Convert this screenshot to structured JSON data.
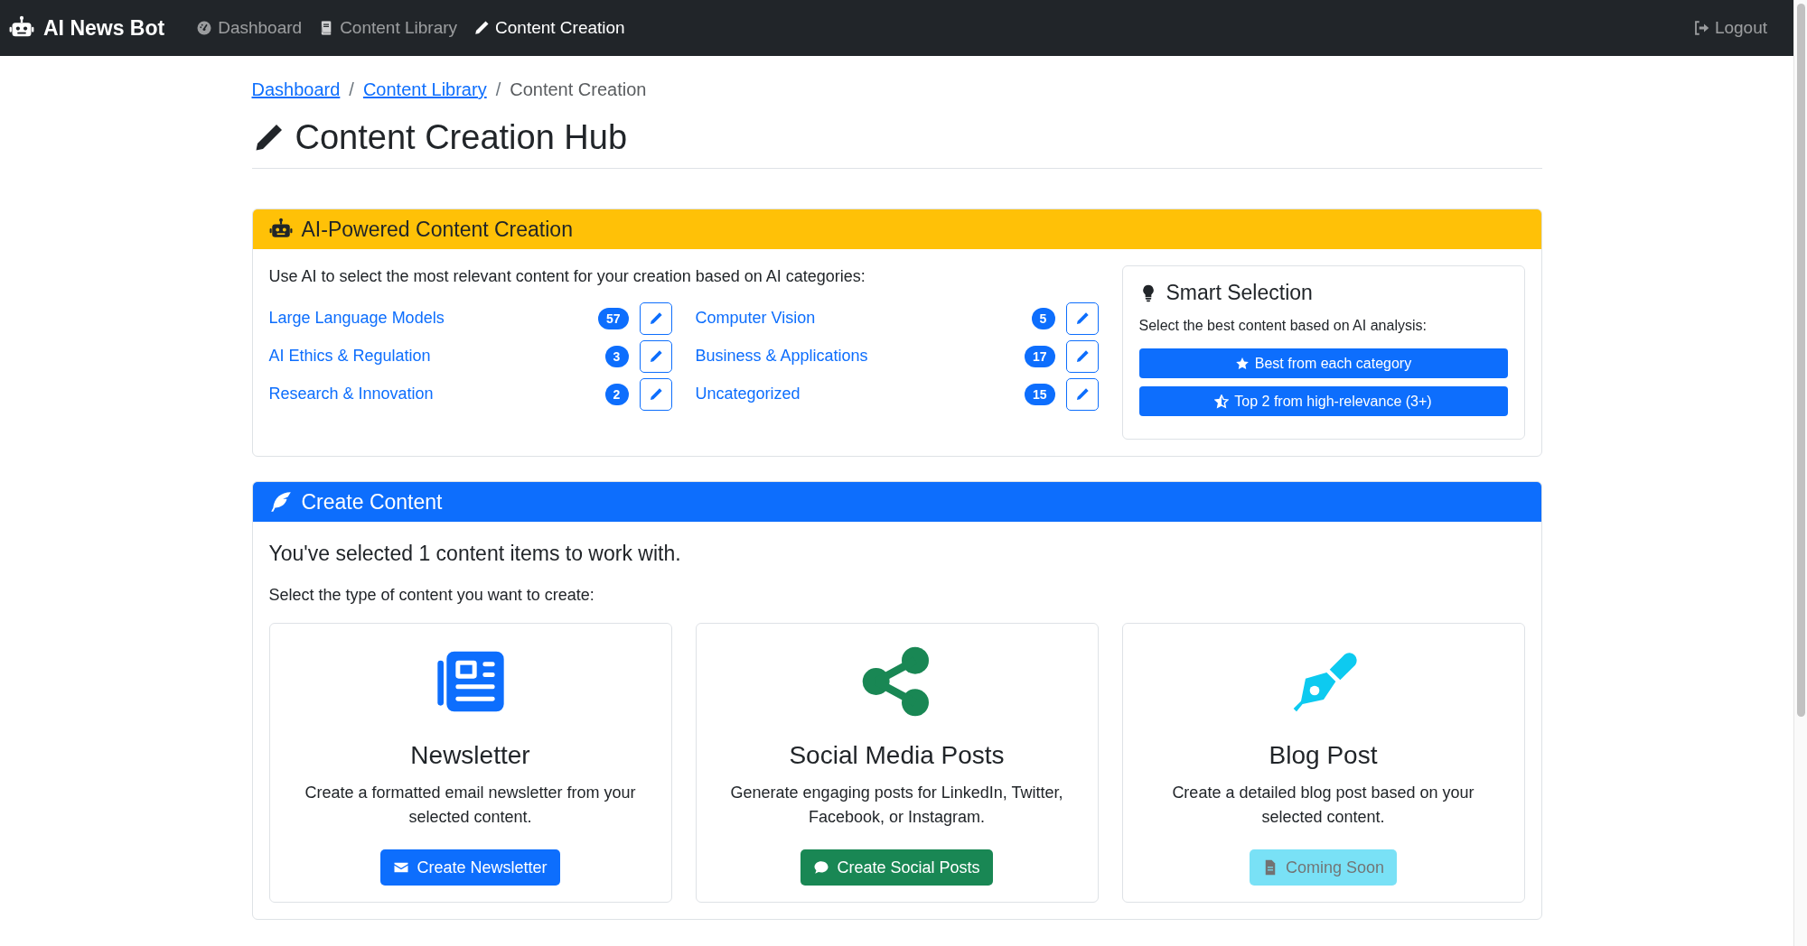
{
  "navbar": {
    "brand": "AI News Bot",
    "items": [
      {
        "label": "Dashboard",
        "kind": "gauge",
        "selected": false
      },
      {
        "label": "Content Library",
        "kind": "book",
        "selected": false
      },
      {
        "label": "Content Creation",
        "kind": "pencil",
        "selected": true
      }
    ],
    "logout": "Logout"
  },
  "breadcrumb": [
    {
      "label": "Dashboard",
      "link": true
    },
    {
      "label": "Content Library",
      "link": true
    },
    {
      "label": "Content Creation",
      "link": false
    }
  ],
  "breadcrumb_separator": "/",
  "page_title": "Content Creation Hub",
  "ai_card": {
    "title": "AI-Powered Content Creation",
    "intro": "Use AI to select the most relevant content for your creation based on AI categories:",
    "categories": [
      {
        "name": "Large Language Models",
        "count": "57"
      },
      {
        "name": "Computer Vision",
        "count": "5"
      },
      {
        "name": "AI Ethics & Regulation",
        "count": "3"
      },
      {
        "name": "Business & Applications",
        "count": "17"
      },
      {
        "name": "Research & Innovation",
        "count": "2"
      },
      {
        "name": "Uncategorized",
        "count": "15"
      }
    ],
    "smart": {
      "title": "Smart Selection",
      "text": "Select the best content based on AI analysis:",
      "buttons": [
        {
          "label": "Best from each category",
          "kind": "star"
        },
        {
          "label": "Top 2 from high-relevance (3+)",
          "kind": "star-half"
        }
      ]
    }
  },
  "create_card": {
    "title": "Create Content",
    "lead": "You've selected 1 content items to work with.",
    "prompt": "Select the type of content you want to create:",
    "options": [
      {
        "kind": "newsletter",
        "title": "Newsletter",
        "description": "Create a formatted email newsletter from your selected content.",
        "button": "Create Newsletter",
        "disabled": false
      },
      {
        "kind": "social",
        "title": "Social Media Posts",
        "description": "Generate engaging posts for LinkedIn, Twitter, Facebook, or Instagram.",
        "button": "Create Social Posts",
        "disabled": false
      },
      {
        "kind": "blog",
        "title": "Blog Post",
        "description": "Create a detailed blog post based on your selected content.",
        "button": "Coming Soon",
        "disabled": true
      }
    ]
  }
}
